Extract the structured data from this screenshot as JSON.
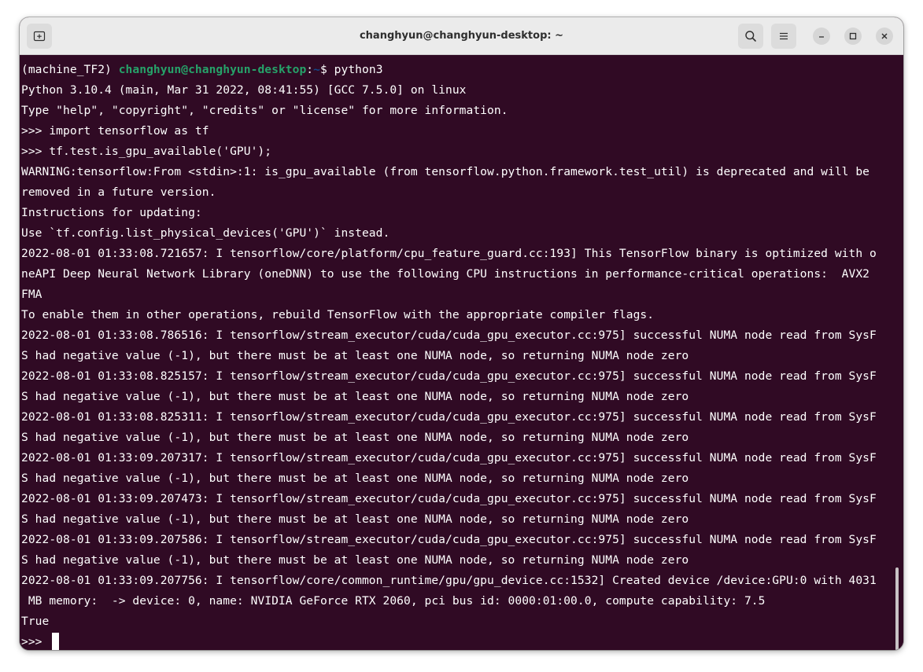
{
  "window": {
    "title": "changhyun@changhyun-desktop: ~"
  },
  "icons": {
    "new_tab": "new-tab-icon",
    "search": "search-icon",
    "menu": "hamburger-menu-icon",
    "minimize": "minimize-icon",
    "maximize": "maximize-icon",
    "close": "close-icon"
  },
  "colors": {
    "terminal_bg": "#300a24",
    "prompt_user": "#26a269",
    "prompt_path": "#12488b",
    "text": "#ffffff"
  },
  "prompt": {
    "env": "(machine_TF2) ",
    "user_host": "changhyun@changhyun-desktop",
    "colon": ":",
    "path": "~",
    "dollar": "$ ",
    "command": "python3"
  },
  "output_lines": [
    "Python 3.10.4 (main, Mar 31 2022, 08:41:55) [GCC 7.5.0] on linux",
    "Type \"help\", \"copyright\", \"credits\" or \"license\" for more information.",
    ">>> import tensorflow as tf",
    ">>> tf.test.is_gpu_available('GPU');",
    "WARNING:tensorflow:From <stdin>:1: is_gpu_available (from tensorflow.python.framework.test_util) is deprecated and will be",
    "removed in a future version.",
    "Instructions for updating:",
    "Use `tf.config.list_physical_devices('GPU')` instead.",
    "2022-08-01 01:33:08.721657: I tensorflow/core/platform/cpu_feature_guard.cc:193] This TensorFlow binary is optimized with o",
    "neAPI Deep Neural Network Library (oneDNN) to use the following CPU instructions in performance-critical operations:  AVX2",
    "FMA",
    "To enable them in other operations, rebuild TensorFlow with the appropriate compiler flags.",
    "2022-08-01 01:33:08.786516: I tensorflow/stream_executor/cuda/cuda_gpu_executor.cc:975] successful NUMA node read from SysF",
    "S had negative value (-1), but there must be at least one NUMA node, so returning NUMA node zero",
    "2022-08-01 01:33:08.825157: I tensorflow/stream_executor/cuda/cuda_gpu_executor.cc:975] successful NUMA node read from SysF",
    "S had negative value (-1), but there must be at least one NUMA node, so returning NUMA node zero",
    "2022-08-01 01:33:08.825311: I tensorflow/stream_executor/cuda/cuda_gpu_executor.cc:975] successful NUMA node read from SysF",
    "S had negative value (-1), but there must be at least one NUMA node, so returning NUMA node zero",
    "2022-08-01 01:33:09.207317: I tensorflow/stream_executor/cuda/cuda_gpu_executor.cc:975] successful NUMA node read from SysF",
    "S had negative value (-1), but there must be at least one NUMA node, so returning NUMA node zero",
    "2022-08-01 01:33:09.207473: I tensorflow/stream_executor/cuda/cuda_gpu_executor.cc:975] successful NUMA node read from SysF",
    "S had negative value (-1), but there must be at least one NUMA node, so returning NUMA node zero",
    "2022-08-01 01:33:09.207586: I tensorflow/stream_executor/cuda/cuda_gpu_executor.cc:975] successful NUMA node read from SysF",
    "S had negative value (-1), but there must be at least one NUMA node, so returning NUMA node zero",
    "2022-08-01 01:33:09.207756: I tensorflow/core/common_runtime/gpu/gpu_device.cc:1532] Created device /device:GPU:0 with 4031",
    " MB memory:  -> device: 0, name: NVIDIA GeForce RTX 2060, pci bus id: 0000:01:00.0, compute capability: 7.5",
    "True"
  ],
  "current_prompt": ">>> "
}
